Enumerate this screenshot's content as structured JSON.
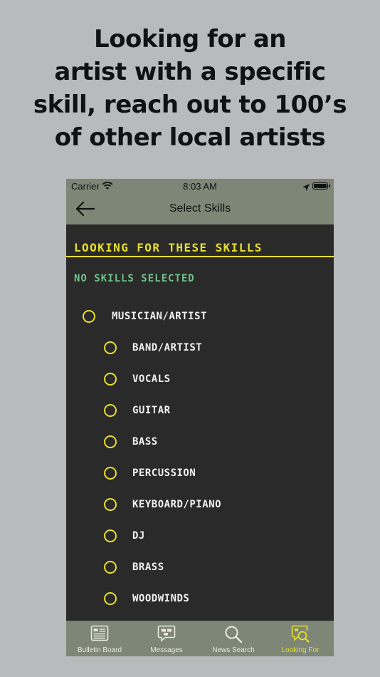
{
  "headline": [
    "Looking for an",
    "artist with a specific",
    "skill, reach out to 100’s",
    "of other local artists"
  ],
  "status_bar": {
    "carrier": "Carrier",
    "time": "8:03 AM"
  },
  "nav": {
    "title": "Select Skills"
  },
  "section": {
    "title": "LOOKING FOR THESE SKILLS",
    "empty_text": "NO SKILLS SELECTED"
  },
  "skills": {
    "parent": "MUSICIAN/ARTIST",
    "children": [
      "BAND/ARTIST",
      "VOCALS",
      "GUITAR",
      "BASS",
      "PERCUSSION",
      "KEYBOARD/PIANO",
      "DJ",
      "BRASS",
      "WOODWINDS"
    ]
  },
  "tabs": [
    {
      "label": "Bulletin Board",
      "icon": "bulletin-board-icon"
    },
    {
      "label": "Messages",
      "icon": "messages-icon"
    },
    {
      "label": "News Search",
      "icon": "search-icon"
    },
    {
      "label": "Looking For",
      "icon": "looking-for-icon",
      "active": true
    }
  ],
  "colors": {
    "accent": "#e8e02a",
    "bar": "#7d8677",
    "panel": "#2a2a2a",
    "empty_text": "#6fc08a",
    "background": "#b9babc"
  }
}
